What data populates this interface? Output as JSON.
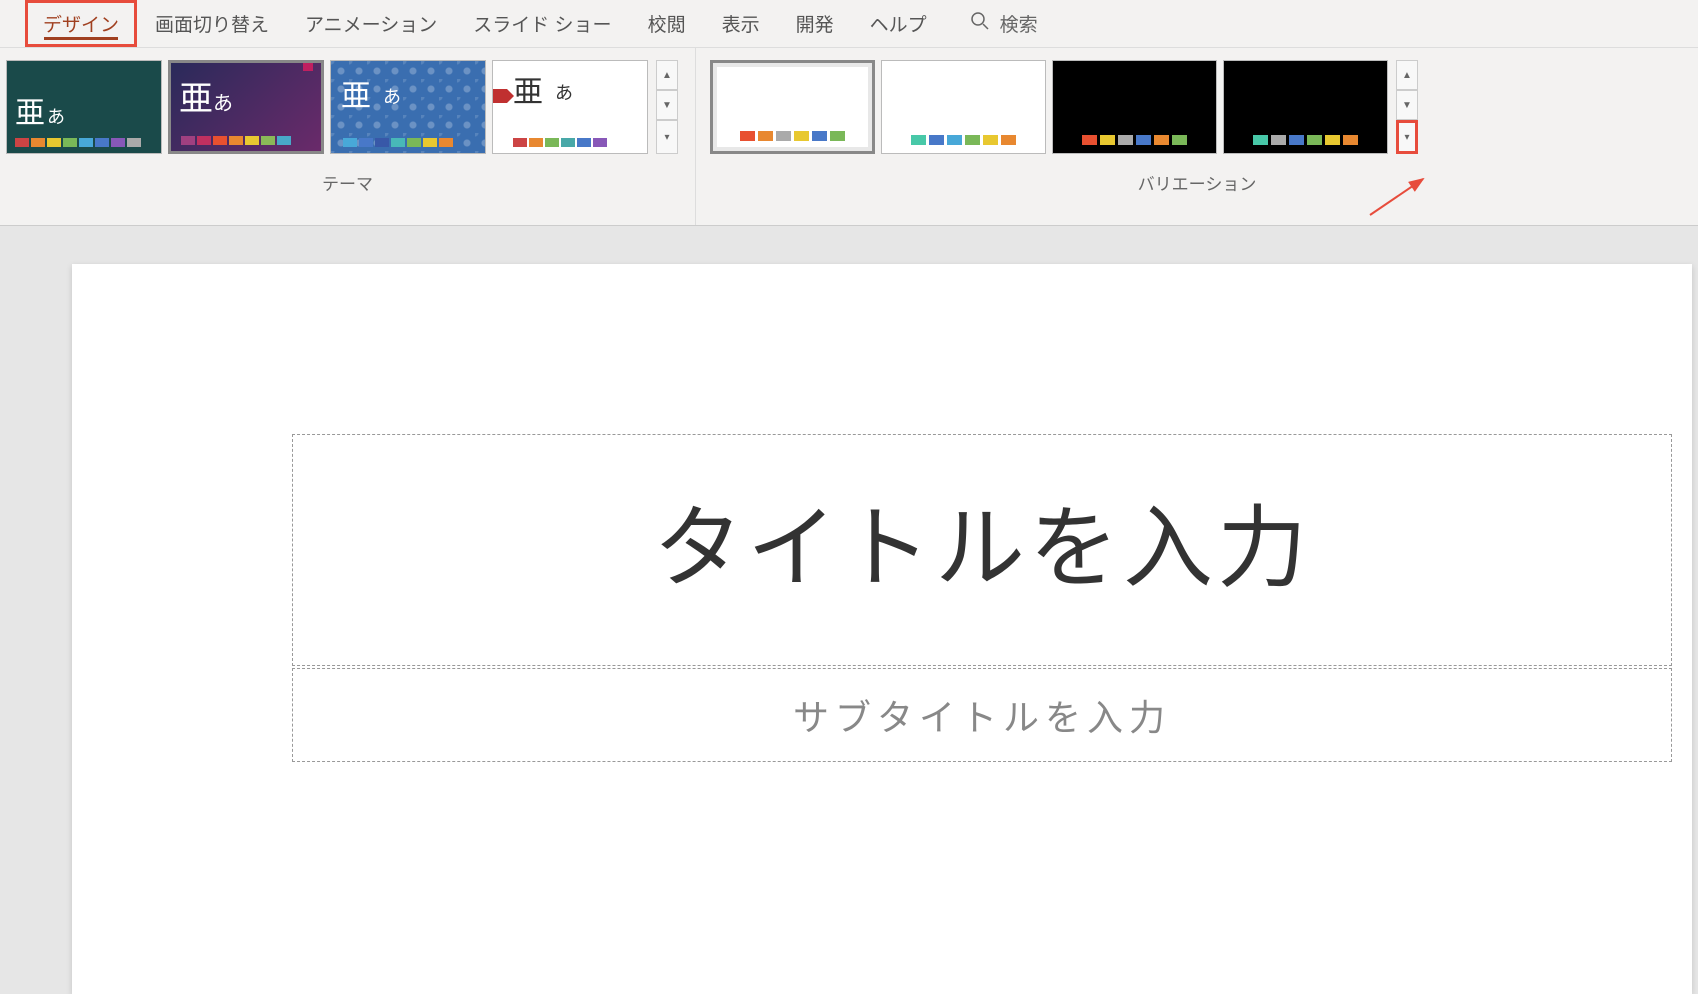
{
  "tabs": {
    "design": "デザイン",
    "transitions": "画面切り替え",
    "animations": "アニメーション",
    "slideshow": "スライド ショー",
    "review": "校閲",
    "view": "表示",
    "developer": "開発",
    "help": "ヘルプ"
  },
  "search": {
    "placeholder": "検索"
  },
  "ribbon": {
    "themes_label": "テーマ",
    "variations_label": "バリエーション",
    "theme_sample_main": "亜",
    "theme_sample_sub": "あ"
  },
  "theme_colors": {
    "set1": [
      "#c44",
      "#e88830",
      "#e8c830",
      "#7ab858",
      "#48a8d8",
      "#4878c8",
      "#8858b8",
      "#aaa"
    ],
    "set2": [
      "#a04080",
      "#c03060",
      "#e85030",
      "#e88830",
      "#e8c830",
      "#8ab858",
      "#48a8c8"
    ],
    "set3": [
      "#48a8d8",
      "#4878c8",
      "#3858a8",
      "#48b8b8",
      "#7ab858",
      "#e8c830",
      "#e88830"
    ],
    "set4": [
      "#c44",
      "#e88830",
      "#7ab858",
      "#48a8a8",
      "#4878c8",
      "#8858b8"
    ]
  },
  "variation_colors": {
    "v1": [
      "#e85030",
      "#e88830",
      "#aaa",
      "#e8c830",
      "#4878c8",
      "#7ab858"
    ],
    "v2": [
      "#48c8a8",
      "#4878c8",
      "#48a8d8",
      "#7ab858",
      "#e8c830",
      "#e88830"
    ],
    "v3": [
      "#e85030",
      "#e8c830",
      "#aaa",
      "#4878c8",
      "#e88830",
      "#7ab858"
    ],
    "v4": [
      "#48c8a8",
      "#aaa",
      "#4878c8",
      "#7ab858",
      "#e8c830",
      "#e88830"
    ]
  },
  "slide": {
    "title_placeholder": "タイトルを入力",
    "subtitle_placeholder": "サブタイトルを入力"
  }
}
